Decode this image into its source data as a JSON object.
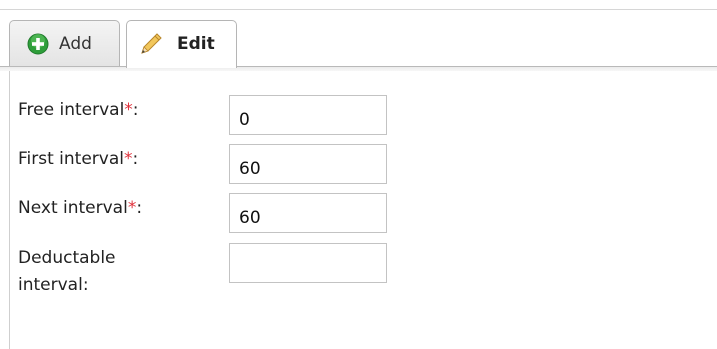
{
  "tabs": [
    {
      "label": "Add",
      "icon": "plus-circle-icon",
      "icon_color": "#2e9e3a",
      "active": false
    },
    {
      "label": "Edit",
      "icon": "pencil-icon",
      "icon_color": "#e3b23c",
      "active": true
    }
  ],
  "form": {
    "required_marker": "*",
    "required_color": "#e0303a",
    "fields": [
      {
        "label": "Free interval",
        "required": true,
        "suffix": ":",
        "value": "0"
      },
      {
        "label": "First interval",
        "required": true,
        "suffix": ":",
        "value": "60"
      },
      {
        "label": "Next interval",
        "required": true,
        "suffix": ":",
        "value": "60"
      },
      {
        "label": "Deductable interval:",
        "required": false,
        "suffix": "",
        "value": ""
      }
    ]
  }
}
